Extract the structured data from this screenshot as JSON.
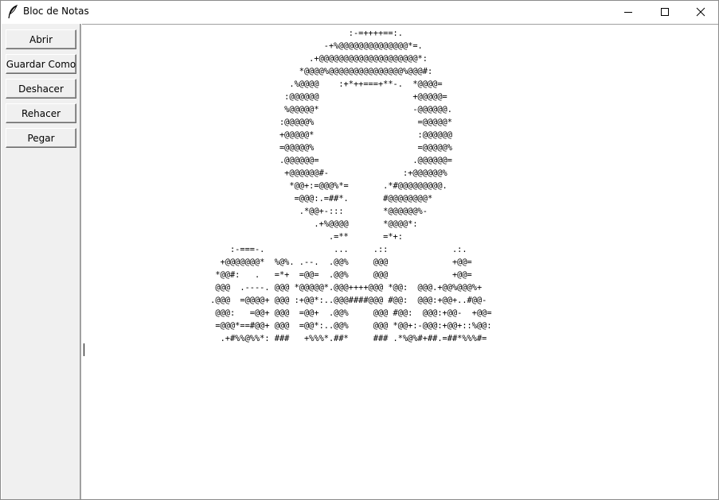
{
  "window": {
    "title": "Bloc de Notas",
    "controls": {
      "minimize": "minimize-icon",
      "maximize": "maximize-icon",
      "close": "close-icon"
    }
  },
  "toolbar": {
    "buttons": [
      {
        "label": "Abrir"
      },
      {
        "label": "Guardar Como"
      },
      {
        "label": "Deshacer"
      },
      {
        "label": "Rehacer"
      },
      {
        "label": "Pegar"
      }
    ]
  },
  "editor": {
    "lines": [
      "                                                      :-=++++==:.",
      "                                                 -+%@@@@@@@@@@@@@@*=.",
      "                                              .+@@@@@@@@@@@@@@@@@@@@*:",
      "                                            *@@@@%@@@@@@@@@@@@@@@%@@@#:",
      "                                          .%@@@@    :+*++===+**-.  *@@@@=",
      "                                         :@@@@@@                   +@@@@@=",
      "                                         %@@@@@*                   -@@@@@@.",
      "                                        :@@@@@%                     =@@@@@*",
      "                                        +@@@@@*                     :@@@@@@",
      "                                        =@@@@@%                     =@@@@@%",
      "                                        .@@@@@@=                   .@@@@@@=",
      "                                         +@@@@@@#-               :+@@@@@@%",
      "                                          *@@+:=@@@%*=       .*#@@@@@@@@@.",
      "                                           =@@@:.=##*.       #@@@@@@@@*",
      "                                            .*@@+-:::        *@@@@@@%-",
      "                                               .+%@@@@       *@@@@*:",
      "                                                  .=**       =*+:",
      "                              :-===-.              ...     .::             .:.",
      "                            +@@@@@@@*  %@%. .--.  .@@%     @@@             +@@=",
      "                           *@@#:   .   =*+  =@@=  .@@%     @@@             +@@=",
      "                           @@@  .----. @@@ *@@@@@*.@@@++++@@@ *@@:  @@@.+@@%@@@%+",
      "                          .@@@  =@@@@+ @@@ :+@@*:..@@@####@@@ #@@:  @@@:+@@+..#@@-",
      "                           @@@:   =@@+ @@@  =@@+  .@@%     @@@ #@@:  @@@:+@@-  +@@=",
      "                           =@@@*==#@@+ @@@  =@@*:..@@%     @@@ *@@+:-@@@:+@@+::%@@:",
      "                            .+#%%@%%*: ###   +%%%*.##*     ### .*%@%#+##.=##*%%%#="
    ]
  }
}
